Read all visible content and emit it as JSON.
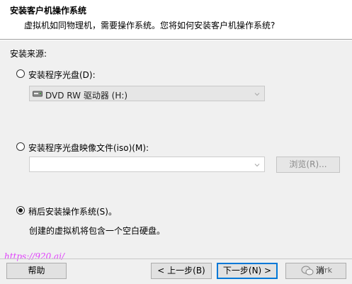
{
  "header": {
    "title": "安装客户机操作系统",
    "subtitle": "虚拟机如同物理机，需要操作系统。您将如何安装客户机操作系统?"
  },
  "install_source_label": "安装来源:",
  "options": {
    "disc": {
      "label": "安装程序光盘(D):",
      "checked": false,
      "drive_value": "DVD RW 驱动器 (H:)"
    },
    "iso": {
      "label": "安装程序光盘映像文件(iso)(M):",
      "checked": false,
      "path_value": "",
      "browse_label": "浏览(R)..."
    },
    "later": {
      "label": "稍后安装操作系统(S)。",
      "checked": true,
      "description": "创建的虚拟机将包含一个空白硬盘。"
    }
  },
  "footer": {
    "help_label": "帮助",
    "back_label": "< 上一步(B)",
    "next_label": "下一步(N) >",
    "cancel_partial": "消",
    "watermark_left": "https://920.ai/",
    "watermark_right": "orrk"
  },
  "icons": {
    "drive": "disc-drive-icon",
    "dropdown": "chevron-down-icon",
    "wechat": "wechat-icon"
  },
  "colors": {
    "header_bg": "#ffffff",
    "window_bg": "#f0f0f0",
    "primary_border": "#0078d7",
    "watermark": "#e040fb"
  }
}
